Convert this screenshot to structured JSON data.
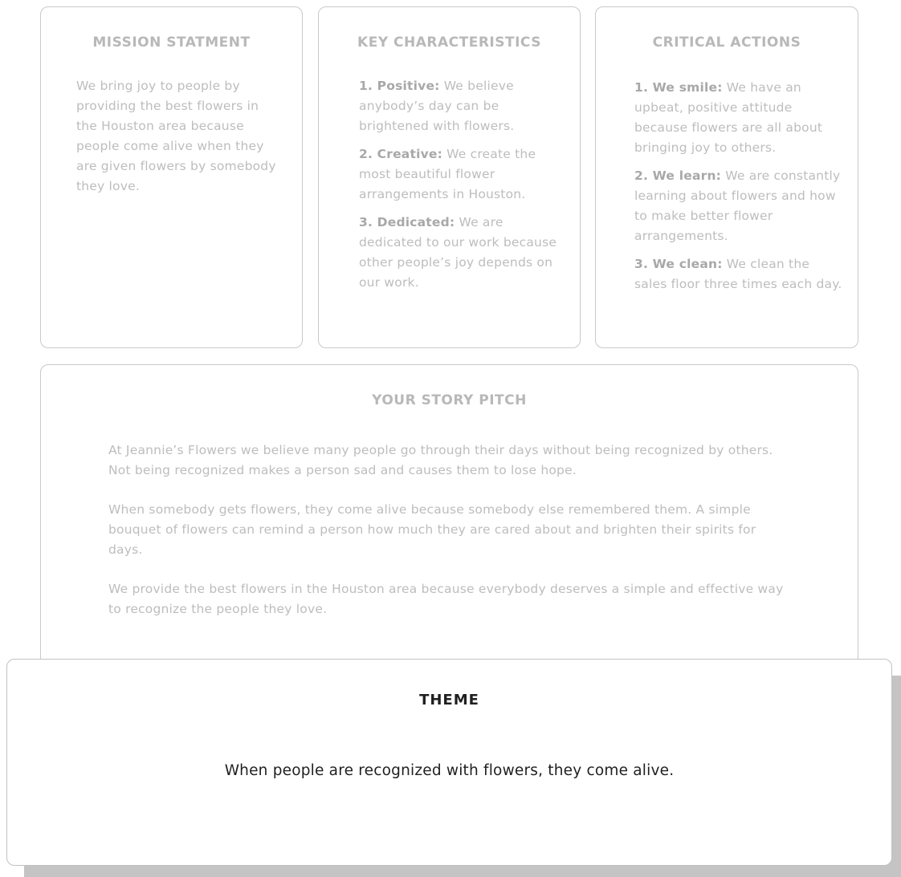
{
  "mission": {
    "title": "MISSION STATMENT",
    "text": "We bring joy to people by providing the best flowers in the Houston area because people come alive when they are given flowers by somebody they love."
  },
  "key_characteristics": {
    "title": "KEY CHARACTERISTICS",
    "items": [
      {
        "label": "1. Positive:",
        "text": " We believe anybody’s day can be brightened with flowers."
      },
      {
        "label": "2. Creative:",
        "text": " We create the most beautiful flower arrangements in Houston."
      },
      {
        "label": "3. Dedicated:",
        "text": " We are dedicated to our work because other people’s joy depends on our work."
      }
    ]
  },
  "critical_actions": {
    "title": "CRITICAL ACTIONS",
    "items": [
      {
        "label": "1. We smile:",
        "text": " We have an upbeat, positive attitude because flowers are all about bringing joy to others."
      },
      {
        "label": "2. We learn:",
        "text": " We are constantly learning about flowers and how to make better flower arrangements."
      },
      {
        "label": "3. We clean:",
        "text": " We clean the sales floor three times each day."
      }
    ]
  },
  "story_pitch": {
    "title": "YOUR STORY PITCH",
    "paragraphs": [
      "At Jeannie’s Flowers we believe many people go through their days without being recognized by others. Not being recognized makes a person sad and causes them to lose hope.",
      "When somebody gets flowers, they come alive because somebody else remembered them. A simple bouquet of flowers can remind a person how much they are cared about and brighten their spirits for days.",
      "We provide the best flowers in the Houston area because everybody deserves a simple and effective way to recognize the people they love."
    ]
  },
  "theme": {
    "title": "THEME",
    "statement": "When people are recognized with flowers, they come alive."
  }
}
